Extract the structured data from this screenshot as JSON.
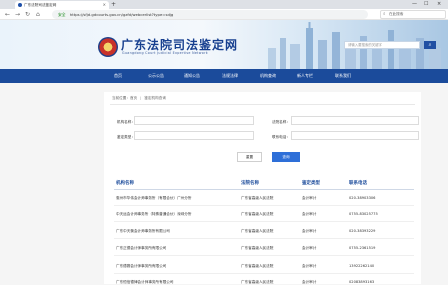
{
  "browser": {
    "tab_title": "广东法院司法鉴定网",
    "tab_close": "×",
    "new_tab": "+",
    "window_controls": [
      "—",
      "☐",
      "×"
    ],
    "url_secure_label": "安全",
    "url": "https://sfjd.gdcourts.gov.cn/gzfd/webcerlist?type=sdjg",
    "search_placeholder": "在此搜索"
  },
  "site": {
    "title": "广东法院司法鉴定网",
    "subtitle": "Guangdong Court Judicial Expertise Network",
    "search_placeholder": "请输入要搜索的关键字",
    "search_icon": "search-icon"
  },
  "nav": {
    "items": [
      "首页",
      "公示公告",
      "通知公告",
      "法规法律",
      "机构查询",
      "新人专栏",
      "联系我们"
    ]
  },
  "breadcrumb": {
    "home": "当前位置：首页",
    "current": "鉴定机构查询"
  },
  "form": {
    "org_name_label": "机构名称：",
    "court_label": "法院名称：",
    "type_label": "鉴定类型：",
    "phone_label": "联系电话：",
    "reset_label": "重置",
    "query_label": "查询"
  },
  "table": {
    "headers": [
      "机构名称",
      "法院名称",
      "鉴定类型",
      "联系电话"
    ],
    "rows": [
      [
        "惠州市华伟会计师事务所（有限合伙）广州分所",
        "广东省高级人民法院",
        "会计审计",
        "020-38903306"
      ],
      [
        "中天运会计师事务所（特殊普通合伙）深圳分所",
        "广东省高级人民法院",
        "会计审计",
        "0755-83025775"
      ],
      [
        "广东中天衡会计师事务所有限公司",
        "广东省高级人民法院",
        "会计审计",
        "020-38393229"
      ],
      [
        "广东正德会计师事务所有限公司",
        "广东省高级人民法院",
        "会计审计",
        "0755-2361519"
      ],
      [
        "广东德赛会计师事务所有限公司",
        "广东省高级人民法院",
        "会计审计",
        "13922262140"
      ],
      [
        "广东恒信德律会计师事务所有限公司",
        "广东省高级人民法院",
        "会计审计",
        "02083893163"
      ]
    ]
  }
}
